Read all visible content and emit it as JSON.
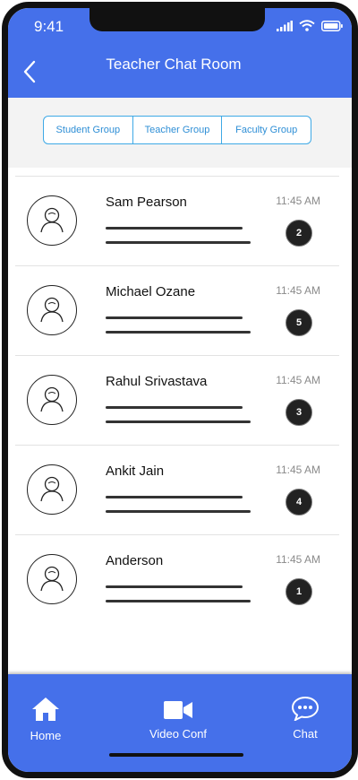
{
  "status_bar": {
    "time": "9:41"
  },
  "header": {
    "title": "Teacher Chat Room"
  },
  "tabs": [
    {
      "label": "Student Group"
    },
    {
      "label": "Teacher Group"
    },
    {
      "label": "Faculty Group"
    }
  ],
  "chats": [
    {
      "name": "Sam Pearson",
      "time": "11:45 AM",
      "unread": "2"
    },
    {
      "name": "Michael Ozane",
      "time": "11:45 AM",
      "unread": "5"
    },
    {
      "name": "Rahul Srivastava",
      "time": "11:45 AM",
      "unread": "3"
    },
    {
      "name": "Ankit Jain",
      "time": "11:45 AM",
      "unread": "4"
    },
    {
      "name": "Anderson",
      "time": "11:45 AM",
      "unread": "1"
    }
  ],
  "bottom_nav": [
    {
      "label": "Home",
      "icon": "home-icon"
    },
    {
      "label": "Video Conf",
      "icon": "video-camera-icon"
    },
    {
      "label": "Chat",
      "icon": "chat-bubble-icon"
    }
  ],
  "colors": {
    "primary": "#4570ea",
    "tab_border": "#3fa9e6",
    "badge": "#222222"
  }
}
